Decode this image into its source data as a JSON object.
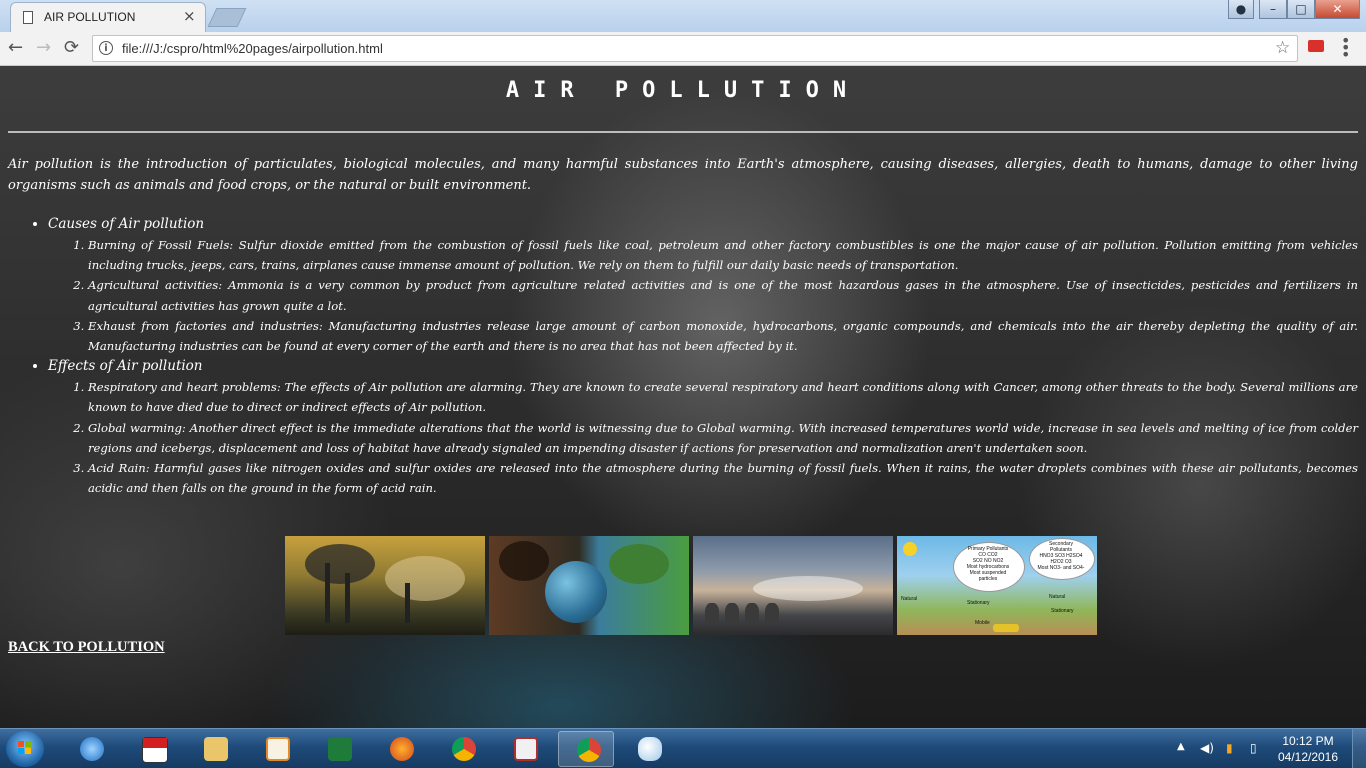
{
  "browser": {
    "tab_title": "AIR POLLUTION",
    "tab_close": "×",
    "url": "file:///J:/cspro/html%20pages/airpollution.html",
    "back_icon": "←",
    "forward_icon": "→",
    "reload_icon": "⟳",
    "star_icon": "☆",
    "menu_icon": "⋮"
  },
  "page": {
    "title": "AIR POLLUTION",
    "intro": "Air pollution is the introduction of particulates, biological molecules, and many harmful substances into Earth's atmosphere, causing diseases, allergies, death to humans, damage to other living organisms such as animals and food crops, or the natural or built environment.",
    "sections": [
      {
        "heading": "Causes of Air pollution",
        "items": [
          "Burning of Fossil Fuels: Sulfur dioxide emitted from the combustion of fossil fuels like coal, petroleum and other factory combustibles is one the major cause of air pollution. Pollution emitting from vehicles including trucks, jeeps, cars, trains, airplanes cause immense amount of pollution. We rely on them to fulfill our daily basic needs of transportation.",
          "Agricultural activities: Ammonia is a very common by product from agriculture related activities and is one of the most hazardous gases in the atmosphere. Use of insecticides, pesticides and fertilizers in agricultural activities has grown quite a lot.",
          "Exhaust from factories and industries: Manufacturing industries release large amount of carbon monoxide, hydrocarbons, organic compounds, and chemicals into the air thereby depleting the quality of air. Manufacturing industries can be found at every corner of the earth and there is no area that has not been affected by it."
        ]
      },
      {
        "heading": "Effects of Air pollution",
        "items": [
          "Respiratory and heart problems: The effects of Air pollution are alarming. They are known to create several respiratory and heart conditions along with Cancer, among other threats to the body. Several millions are known to have died due to direct or indirect effects of Air pollution.",
          "Global warming: Another direct effect is the immediate alterations that the world is witnessing due to Global warming. With increased temperatures world wide, increase in sea levels and melting of ice from colder regions and icebergs, displacement and loss of habitat have already signaled an impending disaster if actions for preservation and normalization aren't undertaken soon.",
          "Acid Rain: Harmful gases like nitrogen oxides and sulfur oxides are released into the atmosphere during the burning of fossil fuels. When it rains, the water droplets combines with these air pollutants, becomes acidic and then falls on the ground in the form of acid rain."
        ]
      }
    ],
    "diagram_text": {
      "primary": "Primary Pollutants\nCO   CO2\nSO2   NO   NO2\nMost hydrocarbons\nMost suspended\nparticles",
      "secondary": "Secondary\nPollutants\nHNO3 SO3 H2SO4\nH2O2  O3\nMost NO3- and SO4-",
      "natural": "Natural",
      "stationary": "Stationary",
      "mobile": "Mobile"
    },
    "back_link": "BACK TO POLLUTION"
  },
  "taskbar": {
    "time": "10:12 PM",
    "date": "04/12/2016",
    "apps": [
      "internet-explorer",
      "iball",
      "file-explorer",
      "media-player",
      "excel",
      "firefox",
      "chrome",
      "presentation",
      "chrome-active",
      "paint"
    ]
  }
}
